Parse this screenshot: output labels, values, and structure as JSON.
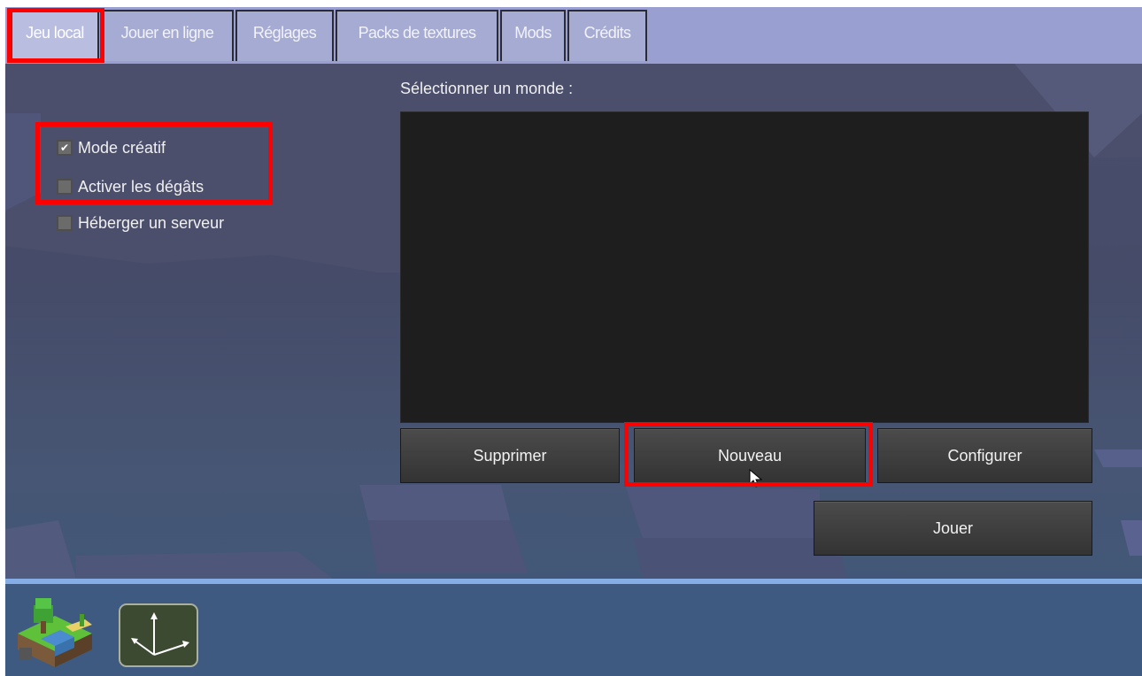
{
  "tabs": [
    {
      "label": "Jeu local",
      "active": true
    },
    {
      "label": "Jouer en ligne",
      "active": false
    },
    {
      "label": "Réglages",
      "active": false
    },
    {
      "label": "Packs de textures",
      "active": false
    },
    {
      "label": "Mods",
      "active": false
    },
    {
      "label": "Crédits",
      "active": false
    }
  ],
  "options": [
    {
      "label": "Mode créatif",
      "checked": true
    },
    {
      "label": "Activer les dégâts",
      "checked": false
    },
    {
      "label": "Héberger un serveur",
      "checked": false
    }
  ],
  "world": {
    "select_label": "Sélectionner un monde :",
    "worlds": []
  },
  "buttons": {
    "delete_label": "Supprimer",
    "new_label": "Nouveau",
    "configure_label": "Configurer",
    "play_label": "Jouer"
  },
  "bottom_icons": [
    "minetest-game-icon",
    "axes-game-icon"
  ],
  "colors": {
    "highlight": "#ff0000",
    "tab_bar": "#9a9fd2",
    "panel_bg": "#1e1e1e",
    "button_bg": "#3e3e3e",
    "accent_line": "#86aee6"
  }
}
